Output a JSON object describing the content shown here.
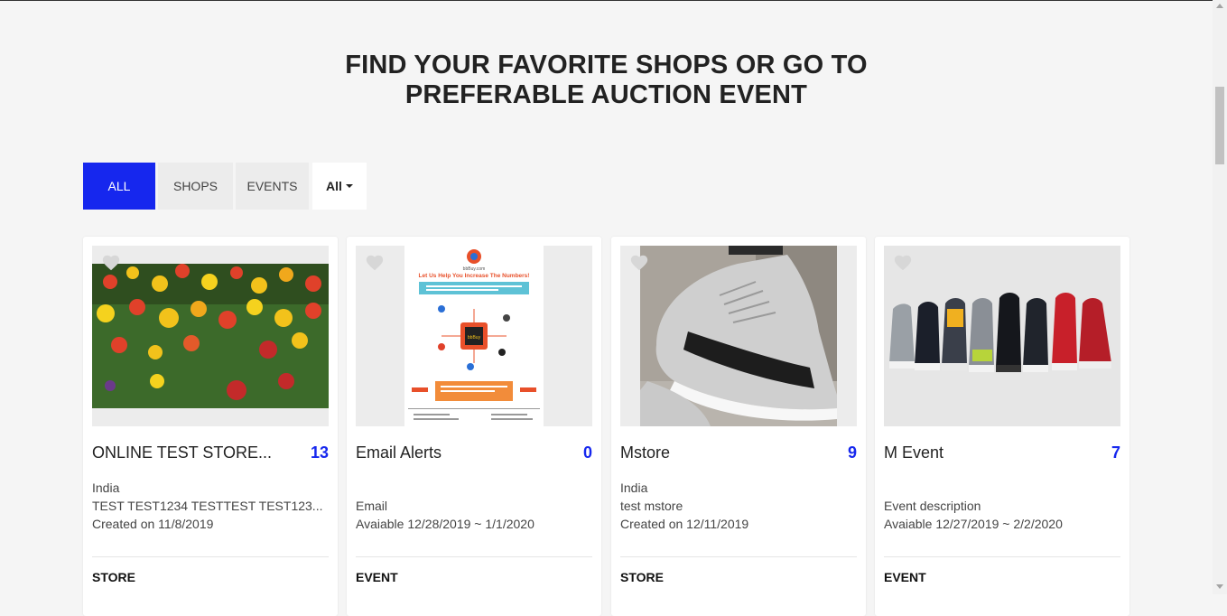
{
  "heading": {
    "line1": "FIND YOUR FAVORITE SHOPS OR GO TO",
    "line2": "PREFERABLE AUCTION EVENT"
  },
  "filters": {
    "all": "ALL",
    "shops": "SHOPS",
    "events": "EVENTS",
    "dropdown_selected": "All"
  },
  "cards": [
    {
      "title": "ONLINE TEST STORE...",
      "count": "13",
      "line1": "India",
      "line2": "TEST TEST1234 TESTTEST TEST123...",
      "line3": "Created on 11/8/2019",
      "type": "STORE",
      "image": "tulip-flowers-photo"
    },
    {
      "title": "Email Alerts",
      "count": "0",
      "line1": "",
      "line2": "Email",
      "line3": "Avaiable 12/28/2019 ~ 1/1/2020",
      "type": "EVENT",
      "image": "infographic-flyer",
      "flyer": {
        "site": "bbBuy.com",
        "headline": "Let Us Help You Increase The Numbers!",
        "center": "bbBuy"
      }
    },
    {
      "title": "Mstore",
      "count": "9",
      "line1": "India",
      "line2": "test mstore",
      "line3": "Created on 12/11/2019",
      "type": "STORE",
      "image": "grey-sneaker-photo"
    },
    {
      "title": "M Event",
      "count": "7",
      "line1": "",
      "line2": "Event description",
      "line3": "Avaiable 12/27/2019 ~ 2/2/2020",
      "type": "EVENT",
      "image": "sneakers-row-photo"
    }
  ],
  "colors": {
    "accent": "#1627ee",
    "background": "#f5f5f5",
    "card": "#ffffff"
  }
}
